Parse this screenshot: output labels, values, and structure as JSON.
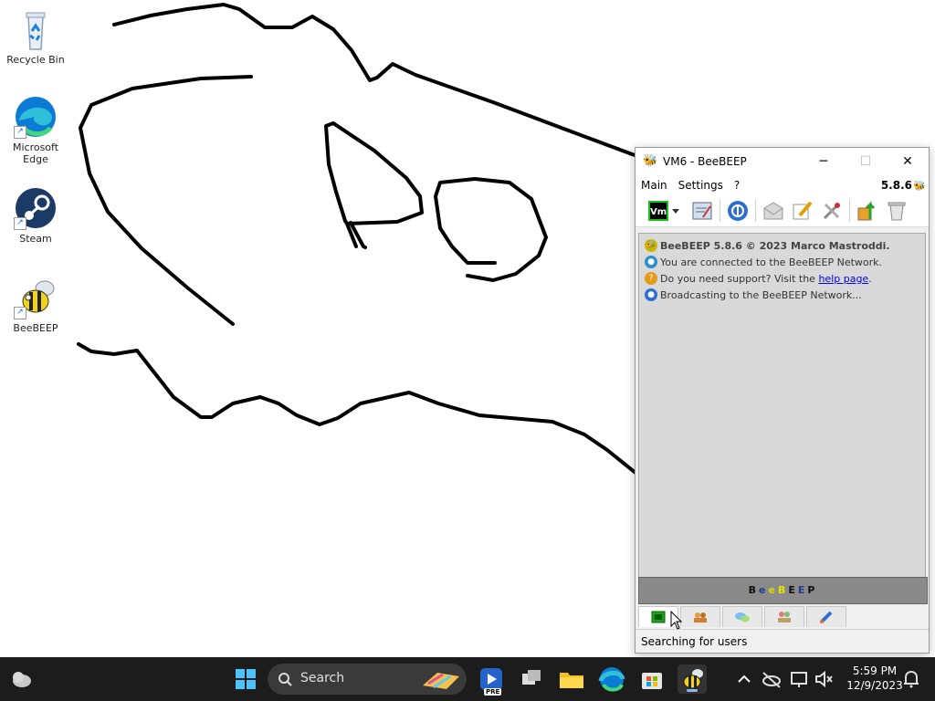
{
  "desktop": {
    "icons": [
      {
        "label": "Recycle Bin"
      },
      {
        "label": "Microsoft Edge"
      },
      {
        "label": "Steam"
      },
      {
        "label": "BeeBEEP"
      }
    ]
  },
  "window": {
    "title": "VM6 - BeeBEEP",
    "controls": {
      "minimize": "─",
      "maximize": "☐",
      "close": "✕"
    },
    "menu": [
      "Main",
      "Settings",
      "?"
    ],
    "version": "5.8.6",
    "toolbar": {
      "status_button": "Vm"
    },
    "chat": {
      "line1": "BeeBEEP 5.8.6 © 2023 Marco Mastroddi.",
      "line2": "You are connected to the BeeBEEP Network.",
      "line3_prefix": "Do you need support? Visit the ",
      "line3_link": "help page",
      "line3_suffix": ".",
      "line4": "Broadcasting to the BeeBEEP Network..."
    },
    "banner": "BeeBEEP",
    "banner_colors": [
      "#111111",
      "#1f3f8a",
      "#d8d800",
      "#e6e600",
      "#111111",
      "#1f3f8a",
      "#111111"
    ],
    "status": "Searching for users"
  },
  "taskbar": {
    "search_placeholder": "Search",
    "badge": "PRE",
    "time": "5:59 PM",
    "date": "12/9/2023"
  }
}
